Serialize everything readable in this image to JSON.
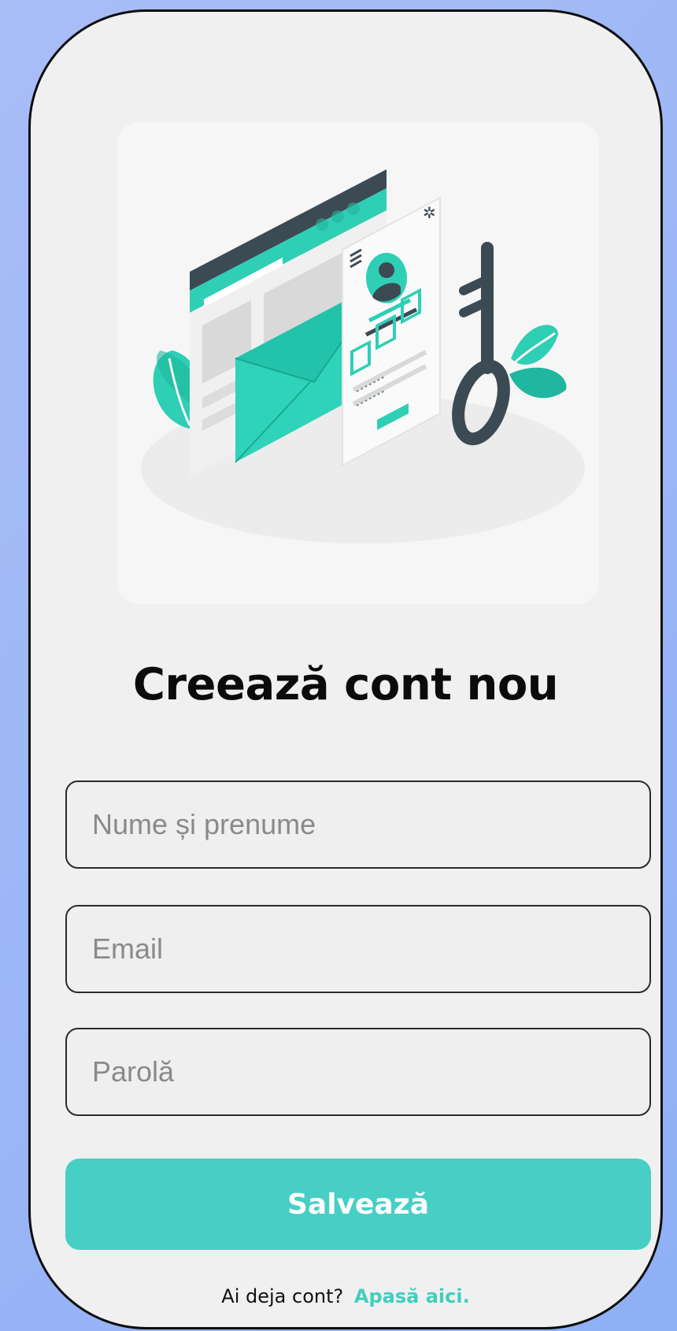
{
  "signup": {
    "title": "Creează cont nou",
    "fields": {
      "full_name_placeholder": "Nume și prenume",
      "email_placeholder": "Email",
      "password_placeholder": "Parolă"
    },
    "save_label": "Salvează",
    "login_prompt": "Ai deja cont?",
    "login_link": "Apasă aici."
  },
  "colors": {
    "accent": "#47cfc6",
    "link": "#43cdbf",
    "background": "#8fb0f5",
    "card": "#f0f0f0"
  }
}
